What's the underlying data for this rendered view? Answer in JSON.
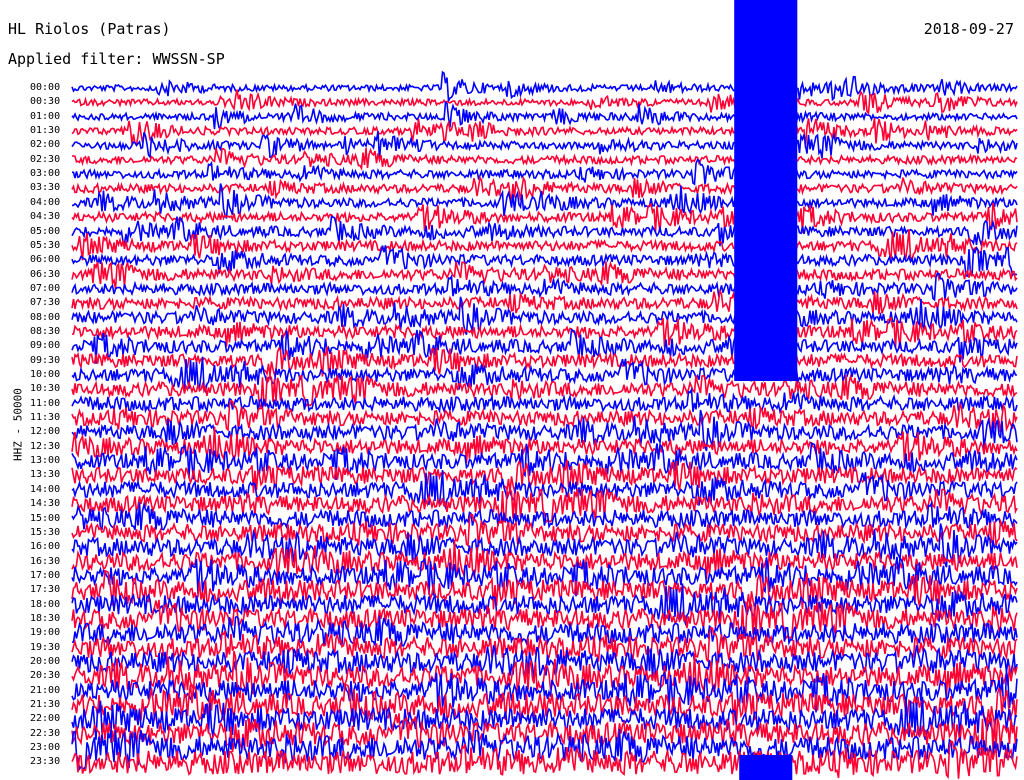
{
  "header": {
    "station": "HL Riolos (Patras)",
    "filter": "Applied filter: WWSSN-SP",
    "date": "2018-09-27"
  },
  "channel_label": "HHZ - 50000",
  "colors": {
    "trace_a": "#0000ff",
    "trace_b": "#ff0033",
    "background": "#ffffff"
  },
  "chart_data": {
    "type": "helicorder",
    "row_labels": [
      "00:00",
      "00:30",
      "01:00",
      "01:30",
      "02:00",
      "02:30",
      "03:00",
      "03:30",
      "04:00",
      "04:30",
      "05:00",
      "05:30",
      "06:00",
      "06:30",
      "07:00",
      "07:30",
      "08:00",
      "08:30",
      "09:00",
      "09:30",
      "10:00",
      "10:30",
      "11:00",
      "11:30",
      "12:00",
      "12:30",
      "13:00",
      "13:30",
      "14:00",
      "14:30",
      "15:00",
      "15:30",
      "16:00",
      "16:30",
      "17:00",
      "17:30",
      "18:00",
      "18:30",
      "19:00",
      "19:30",
      "20:00",
      "20:30",
      "21:00",
      "21:30",
      "22:00",
      "22:30",
      "23:00",
      "23:30"
    ],
    "minutes_per_row": 15,
    "color_cycle": [
      "blue",
      "red"
    ],
    "event": {
      "start_minute": 10.5,
      "end_minute": 11.5,
      "first_row": "00:00",
      "last_row": "10:00"
    }
  }
}
